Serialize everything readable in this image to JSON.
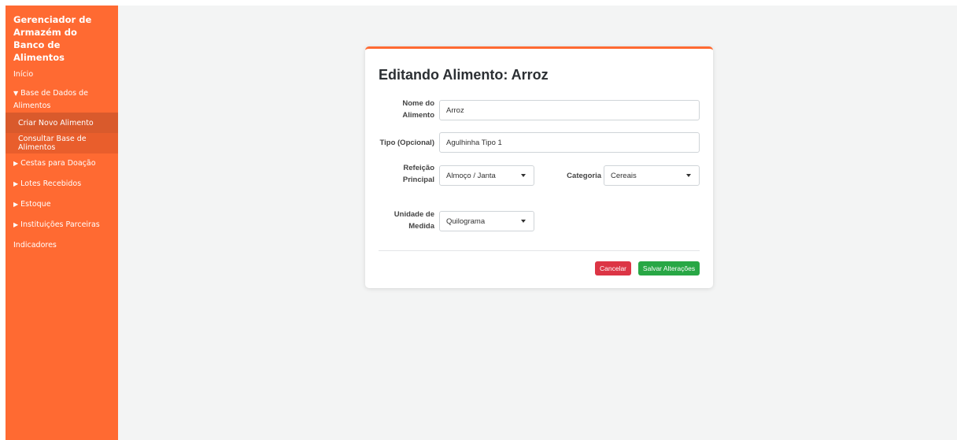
{
  "sidebar": {
    "brand": "Gerenciador de Armazém do Banco de Alimentos",
    "items": {
      "inicio": "Início",
      "base_dados": "Base de Dados de Alimentos",
      "criar": "Criar Novo Alimento",
      "consultar": "Consultar Base de Alimentos",
      "cestas": "Cestas para Doação",
      "lotes": "Lotes Recebidos",
      "estoque": "Estoque",
      "instituicoes": "Instituições Parceiras",
      "indicadores": "Indicadores"
    },
    "caret_open": "▼",
    "caret_closed": "▶",
    "colors": {
      "background": "#ff6a32",
      "active": "#d95a2c"
    }
  },
  "form": {
    "title": "Editando Alimento: Arroz",
    "nome_label": "Nome do Alimento",
    "nome_value": "Arroz",
    "tipo_label": "Tipo (Opcional)",
    "tipo_value": "Agulhinha Tipo 1",
    "refeicao_label": "Refeição Principal",
    "refeicao_value": "Almoço / Janta",
    "categoria_label": "Categoria",
    "categoria_value": "Cereais",
    "unidade_label": "Unidade de Medida",
    "unidade_value": "Quilograma",
    "cancel_label": "Cancelar",
    "save_label": "Salvar Alterações",
    "colors": {
      "accent": "#ff6a32",
      "cancel": "#dc3545",
      "save": "#28a745"
    }
  }
}
